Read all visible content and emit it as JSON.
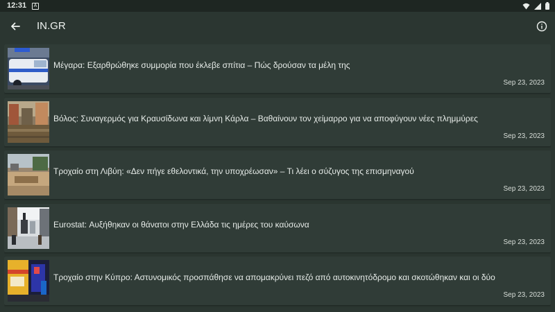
{
  "status_bar": {
    "time": "12:31",
    "notification_glyph": "A",
    "icons": [
      "wifi-icon",
      "signal-icon",
      "battery-icon"
    ]
  },
  "app_bar": {
    "title": "IN.GR",
    "back_icon": "arrow-left-icon",
    "info_icon": "info-circle-icon"
  },
  "articles": [
    {
      "headline": "Μέγαρα: Εξαρθρώθηκε συμμορία που έκλεβε σπίτια – Πώς δρούσαν τα μέλη της",
      "date": "Sep 23, 2023"
    },
    {
      "headline": "Βόλος: Συναγερμός για Κραυσίδωνα και λίμνη Κάρλα – Βαθαίνουν τον χείμαρρο για να αποφύγουν νέες πλημμύρες",
      "date": "Sep 23, 2023"
    },
    {
      "headline": "Τροχαίο στη Λιβύη: «Δεν πήγε εθελοντικά, την υποχρέωσαν» – Τι λέει ο σύζυγος της επισμηναγού",
      "date": "Sep 23, 2023"
    },
    {
      "headline": "Eurostat: Αυξήθηκαν οι θάνατοι στην Ελλάδα τις ημέρες του καύσωνα",
      "date": "Sep 23, 2023"
    },
    {
      "headline": "Τροχαίο στην Κύπρο: Αστυνομικός προσπάθησε να απομακρύνει πεζό από αυτοκινητόδρομο και σκοτώθηκαν και οι δύο",
      "date": "Sep 23, 2023"
    }
  ],
  "colors": {
    "background": "#2b3631",
    "card": "#303c37",
    "status_bar": "#1e2622",
    "text": "#e7ece9"
  }
}
